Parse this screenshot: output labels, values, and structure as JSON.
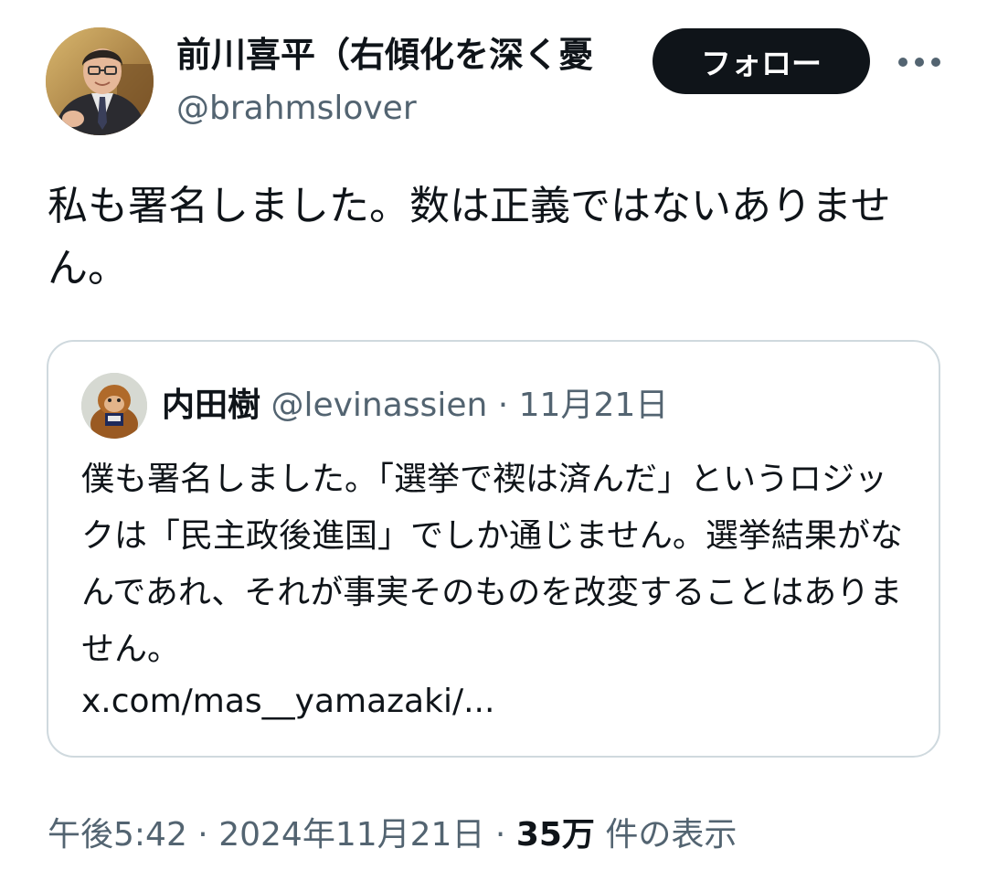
{
  "author": {
    "display_name": "前川喜平（右傾化を深く憂",
    "handle": "@brahmslover"
  },
  "header": {
    "follow_label": "フォロー",
    "more_icon": "more-horizontal-icon"
  },
  "tweet": {
    "text": "私も署名しました。数は正義ではないありません。"
  },
  "quote": {
    "display_name": "内田樹",
    "handle": "@levinassien",
    "separator": "·",
    "date": "11月21日",
    "text": "僕も署名しました。「選挙で禊は済んだ」というロジックは「民主政後進国」でしか通じません。選挙結果がなんであれ、それが事実そのものを改変することはありません。",
    "link": "x.com/mas__yamazaki/..."
  },
  "meta": {
    "time": "午後5:42",
    "sep1": "·",
    "date": "2024年11月21日",
    "sep2": "·",
    "views_count": "35万",
    "views_label": "件の表示"
  },
  "colors": {
    "text_primary": "#0f1419",
    "text_secondary": "#536471",
    "border": "#cfd9de",
    "follow_bg": "#0f1419"
  }
}
